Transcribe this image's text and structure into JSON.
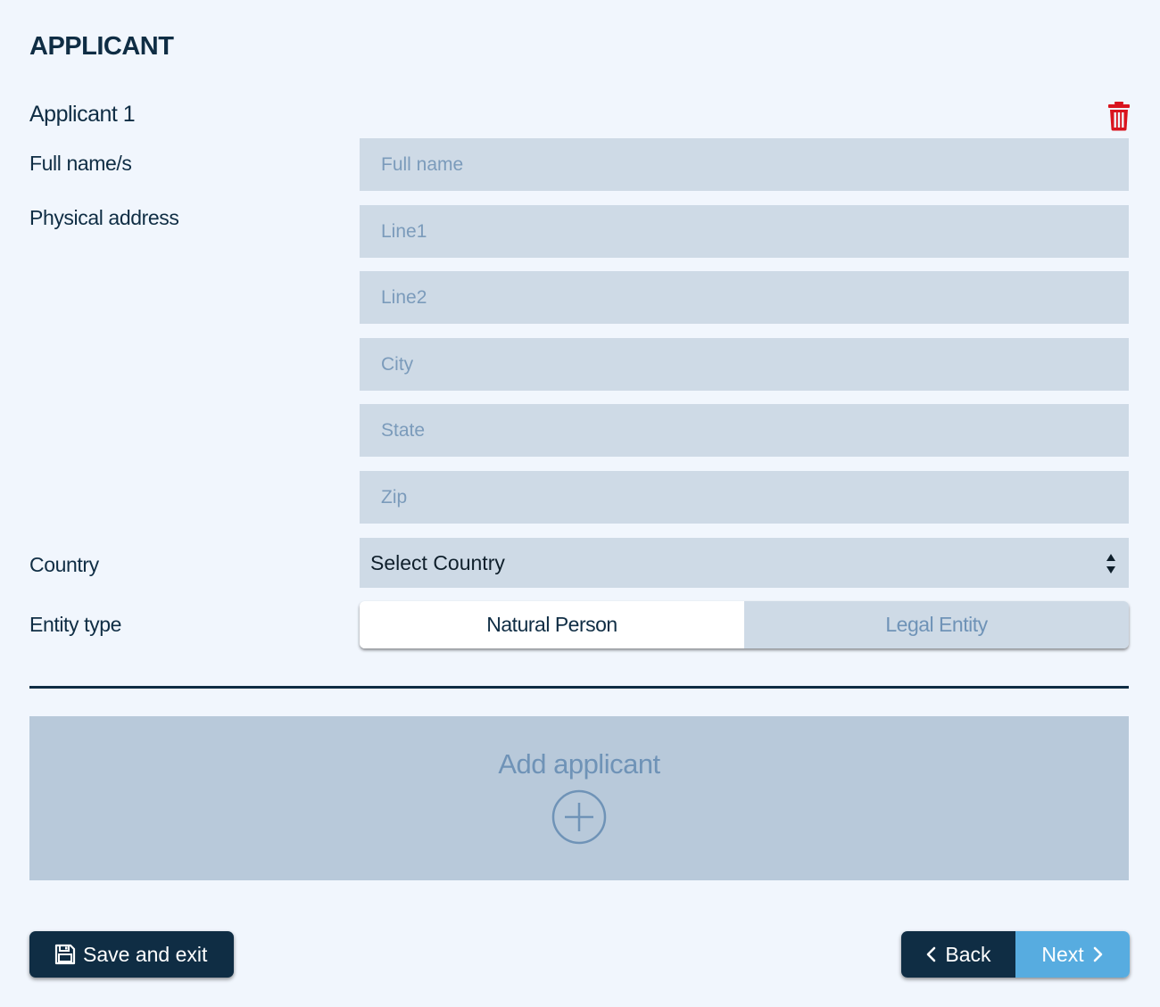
{
  "page": {
    "title": "APPLICANT"
  },
  "applicant": {
    "title": "Applicant 1",
    "labels": {
      "full_name": "Full name/s",
      "physical_address": "Physical address",
      "country": "Country",
      "entity_type": "Entity type"
    },
    "fields": {
      "full_name_placeholder": "Full name",
      "line1_placeholder": "Line1",
      "line2_placeholder": "Line2",
      "city_placeholder": "City",
      "state_placeholder": "State",
      "zip_placeholder": "Zip"
    },
    "country_select": {
      "selected": "Select Country"
    },
    "entity_type": {
      "options": [
        "Natural Person",
        "Legal Entity"
      ],
      "selected": "Natural Person"
    }
  },
  "add_applicant": {
    "label": "Add applicant"
  },
  "footer": {
    "save_label": "Save and exit",
    "back_label": "Back",
    "next_label": "Next"
  },
  "colors": {
    "primary": "#0f2d44",
    "accent": "#57ace0",
    "delete": "#d9141e",
    "background": "#f1f6fd"
  },
  "icons": {
    "delete": "trash-icon",
    "select": "sort-arrows-icon",
    "add": "plus-circle-icon",
    "save": "floppy-disk-icon",
    "back": "chevron-left-icon",
    "next": "chevron-right-icon"
  }
}
